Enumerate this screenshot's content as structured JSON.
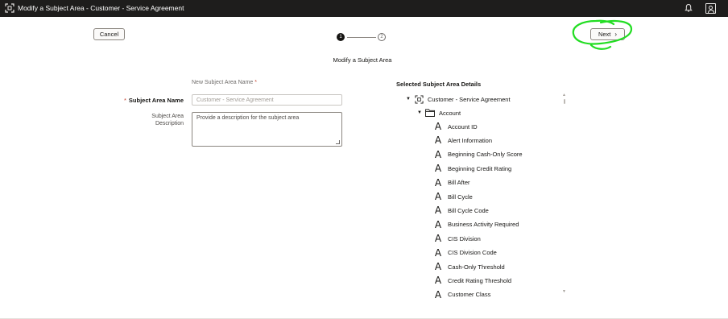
{
  "header": {
    "title": "Modify a Subject Area - Customer - Service Agreement",
    "app_icon": "subject-area-icon",
    "notifications_icon": "bell-icon",
    "user_icon": "user-avatar-icon"
  },
  "toolbar": {
    "cancel_label": "Cancel",
    "next_label": "Next",
    "next_chevron": "›"
  },
  "stepper": {
    "step1": "1",
    "step2": "2",
    "current_step": 1,
    "title": "Modify a Subject Area"
  },
  "form": {
    "hint": "New Subject Area Name",
    "required_mark": "*",
    "name_label": "Subject Area Name",
    "name_value": "Customer - Service Agreement",
    "description_label": "Subject Area Description",
    "description_placeholder": "Provide a description for the subject area"
  },
  "details": {
    "title": "Selected Subject Area Details",
    "root": {
      "label": "Customer - Service Agreement",
      "icon": "subject-area-icon",
      "expanded": true
    },
    "folder": {
      "label": "Account",
      "icon": "folder-icon",
      "expanded": true
    },
    "attributes": [
      "Account ID",
      "Alert Information",
      "Beginning Cash-Only Score",
      "Beginning Credit Rating",
      "Bill After",
      "Bill Cycle",
      "Bill Cycle Code",
      "Business Activity Required",
      "CIS Division",
      "CIS Division Code",
      "Cash-Only Threshold",
      "Credit Rating Threshold",
      "Customer Class"
    ],
    "attribute_icon": "attribute-icon",
    "attribute_glyph": "A"
  },
  "colors": {
    "titlebar": "#1e1d1c",
    "required": "#c74634",
    "highlight_scribble": "#22dd22"
  }
}
